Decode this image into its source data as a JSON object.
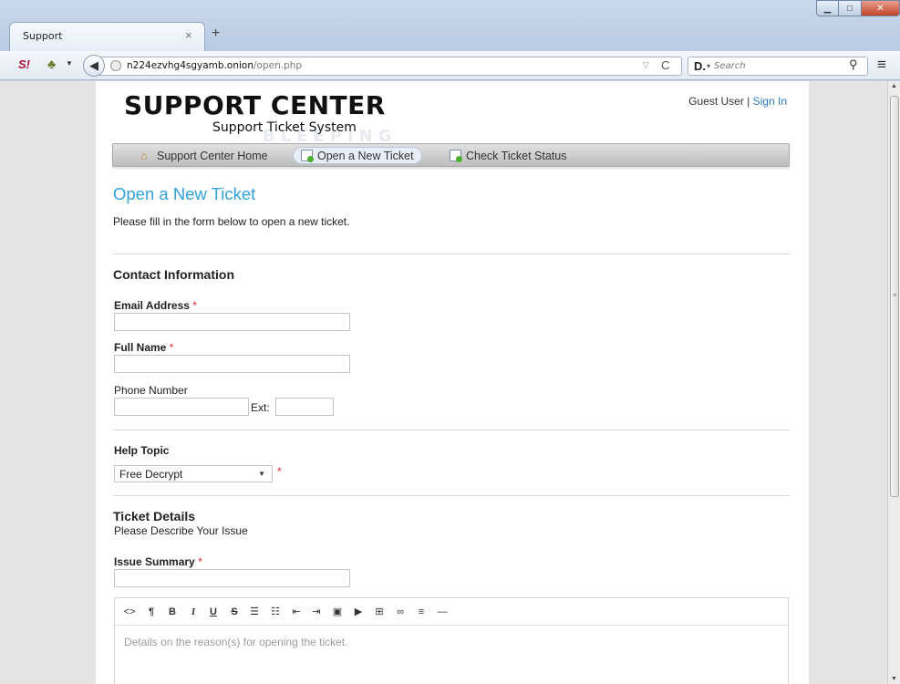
{
  "browser": {
    "tab_title": "Support",
    "tab_close": "×",
    "new_tab": "+",
    "url_host": "n224ezvhg4sgyamb.onion",
    "url_path": "/open.php",
    "search_placeholder": "Search",
    "engine_label": "D."
  },
  "page": {
    "logo_title": "SUPPORT CENTER",
    "logo_subtitle": "Support Ticket System",
    "watermark": "BLEEPING",
    "user_label": "Guest User",
    "separator": "|",
    "sign_in": "Sign In",
    "nav": [
      {
        "label": "Support Center Home",
        "icon": "home-icon"
      },
      {
        "label": "Open a New Ticket",
        "icon": "new-ticket-icon"
      },
      {
        "label": "Check Ticket Status",
        "icon": "ticket-status-icon"
      }
    ],
    "heading": "Open a New Ticket",
    "intro": "Please fill in the form below to open a new ticket."
  },
  "form": {
    "contact_header": "Contact Information",
    "email_label": "Email Address",
    "full_name_label": "Full Name",
    "phone_label": "Phone Number",
    "ext_label": "Ext:",
    "required_mark": "*",
    "help_topic_label": "Help Topic",
    "help_topic_value": "Free Decrypt",
    "ticket_details_header": "Ticket Details",
    "ticket_details_sub": "Please Describe Your Issue",
    "issue_summary_label": "Issue Summary",
    "details_placeholder": "Details on the reason(s) for opening the ticket."
  },
  "editor_toolbar": [
    {
      "glyph": "<>",
      "icon": "html-icon"
    },
    {
      "glyph": "¶",
      "icon": "paragraph-icon"
    },
    {
      "glyph": "B",
      "icon": "bold-icon"
    },
    {
      "glyph": "I",
      "icon": "italic-icon"
    },
    {
      "glyph": "U",
      "icon": "underline-icon"
    },
    {
      "glyph": "S",
      "icon": "strikethrough-icon"
    },
    {
      "glyph": "☰",
      "icon": "unordered-list-icon"
    },
    {
      "glyph": "☷",
      "icon": "ordered-list-icon"
    },
    {
      "glyph": "⇤",
      "icon": "outdent-icon"
    },
    {
      "glyph": "⇥",
      "icon": "indent-icon"
    },
    {
      "glyph": "▣",
      "icon": "image-icon"
    },
    {
      "glyph": "▶",
      "icon": "video-icon"
    },
    {
      "glyph": "⊞",
      "icon": "table-icon"
    },
    {
      "glyph": "∞",
      "icon": "link-icon"
    },
    {
      "glyph": "≡",
      "icon": "align-icon"
    },
    {
      "glyph": "—",
      "icon": "horizontal-rule-icon"
    }
  ],
  "colors": {
    "accent": "#31a1dc",
    "link": "#2a7bbd",
    "required": "#e4272c"
  }
}
